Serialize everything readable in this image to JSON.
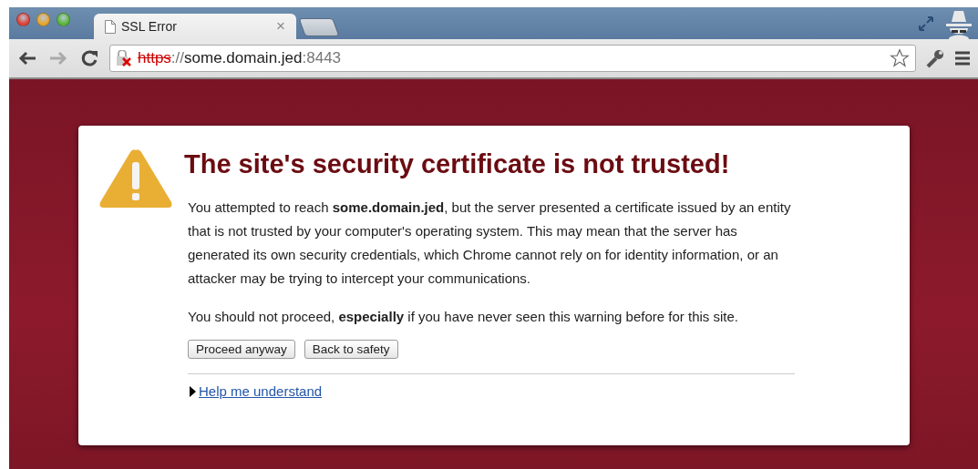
{
  "tabs": [
    {
      "title": "SSL Error",
      "selected": true,
      "close": "×"
    }
  ],
  "address_bar": {
    "scheme": "https",
    "separator": "://",
    "host": "some.domain.jed",
    "port": ":8443"
  },
  "error": {
    "title": "The site's security certificate is not trusted!",
    "paragraphs": [
      "You attempted to reach **some.domain.jed**, but the server presented a certificate issued by an entity that is not trusted by your computer's operating system. This may mean that the server has generated its own security credentials, which Chrome cannot rely on for identity information, or an attacker may be trying to intercept your communications.",
      "You should not proceed, **especially** if you have never seen this warning before for this site."
    ],
    "buttons": [
      "Proceed anyway",
      "Back to safety"
    ],
    "help_link": {
      "label": "Help me understand",
      "expanded": false
    }
  }
}
